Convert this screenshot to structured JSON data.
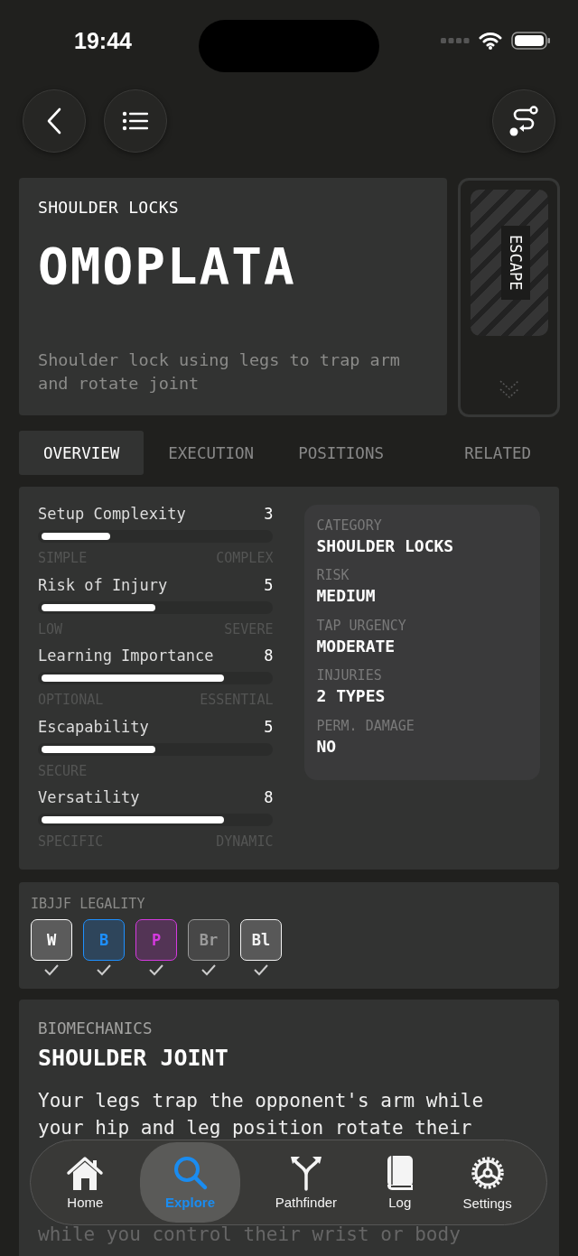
{
  "status_bar": {
    "time": "19:44"
  },
  "header": {
    "category": "SHOULDER LOCKS",
    "title": "OMOPLATA",
    "description": "Shoulder lock using legs to trap arm and rotate joint",
    "side_label": "ESCAPE"
  },
  "tabs": [
    {
      "label": "OVERVIEW",
      "selected": true
    },
    {
      "label": "EXECUTION",
      "selected": false
    },
    {
      "label": "POSITIONS",
      "selected": false
    },
    {
      "label": "RELATED",
      "selected": false
    }
  ],
  "stats": [
    {
      "name": "Setup Complexity",
      "value": "3",
      "level": 0.3,
      "low": "SIMPLE",
      "high": "COMPLEX"
    },
    {
      "name": "Risk of Injury",
      "value": "5",
      "level": 0.5,
      "low": "LOW",
      "high": "SEVERE"
    },
    {
      "name": "Learning Importance",
      "value": "8",
      "level": 0.8,
      "low": "OPTIONAL",
      "high": "ESSENTIAL"
    },
    {
      "name": "Escapability",
      "value": "5",
      "level": 0.5,
      "low": "SECURE"
    },
    {
      "name": "Versatility",
      "value": "8",
      "level": 0.8,
      "low": "SPECIFIC",
      "high": "DYNAMIC"
    }
  ],
  "info": [
    {
      "label": "CATEGORY",
      "value": "SHOULDER LOCKS"
    },
    {
      "label": "RISK",
      "value": "MEDIUM"
    },
    {
      "label": "TAP URGENCY",
      "value": "MODERATE"
    },
    {
      "label": "INJURIES",
      "value": "2 TYPES"
    },
    {
      "label": "PERM. DAMAGE",
      "value": "NO"
    }
  ],
  "legality": {
    "title": "IBJJF LEGALITY",
    "belts": [
      {
        "label": "W",
        "color": "#ffffff",
        "checked": true
      },
      {
        "label": "B",
        "color": "#1e90ff",
        "checked": true
      },
      {
        "label": "P",
        "color": "#d63ae0",
        "checked": true
      },
      {
        "label": "Br",
        "color": "#9a9a9a",
        "checked": true
      },
      {
        "label": "Bl",
        "color": "#f2f2f2",
        "checked": true
      }
    ]
  },
  "biomechanics": {
    "label": "BIOMECHANICS",
    "title": "SHOULDER JOINT",
    "lines_above": [
      "Your legs trap the opponent's arm while",
      "your hip and leg position rotate their"
    ],
    "lines_below": [
      "while you control their wrist or body"
    ]
  },
  "tab_bar": [
    {
      "label": "Home",
      "selected": false
    },
    {
      "label": "Explore",
      "selected": true
    },
    {
      "label": "Pathfinder",
      "selected": false
    },
    {
      "label": "Log",
      "selected": false
    },
    {
      "label": "Settings",
      "selected": false
    }
  ]
}
